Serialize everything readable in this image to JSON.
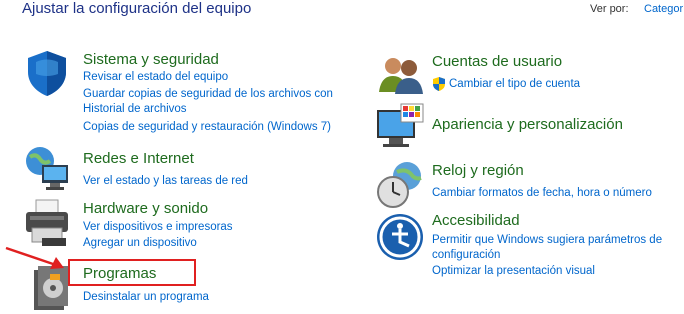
{
  "header": {
    "title": "Ajustar la configuración del equipo",
    "view_by_label": "Ver por:",
    "view_by_value": "Categoría"
  },
  "categories": {
    "system": {
      "title": "Sistema y seguridad",
      "links": [
        "Revisar el estado del equipo",
        "Guardar copias de seguridad de los archivos con",
        "Historial de archivos",
        "Copias de seguridad y restauración (Windows 7)"
      ]
    },
    "network": {
      "title": "Redes e Internet",
      "links": [
        "Ver el estado y las tareas de red"
      ]
    },
    "hardware": {
      "title": "Hardware y sonido",
      "links": [
        "Ver dispositivos e impresoras",
        "Agregar un dispositivo"
      ]
    },
    "programs": {
      "title": "Programas",
      "links": [
        "Desinstalar un programa"
      ]
    },
    "accounts": {
      "title": "Cuentas de usuario",
      "links": [
        "Cambiar el tipo de cuenta"
      ]
    },
    "appearance": {
      "title": "Apariencia y personalización",
      "links": []
    },
    "clock": {
      "title": "Reloj y región",
      "links": [
        "Cambiar formatos de fecha, hora o número"
      ]
    },
    "accessibility": {
      "title": "Accesibilidad",
      "links": [
        "Permitir que Windows sugiera parámetros de",
        "configuración",
        "Optimizar la presentación visual"
      ]
    }
  },
  "icons": {
    "system": "shield-icon",
    "network": "globe-network-icon",
    "hardware": "printer-icon",
    "programs": "program-disc-icon",
    "accounts": "users-icon",
    "appearance": "monitor-palette-icon",
    "clock": "clock-globe-icon",
    "accessibility": "accessibility-icon",
    "uac": "uac-shield-icon"
  },
  "colors": {
    "heading": "#1e6b1e",
    "link": "#0066cc",
    "title": "#1e3287",
    "highlight": "#e02020"
  }
}
